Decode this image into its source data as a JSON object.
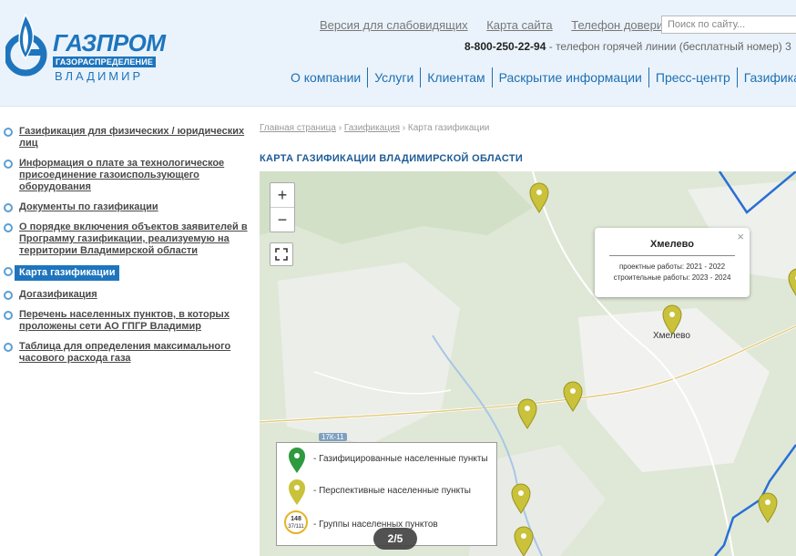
{
  "header": {
    "logo": {
      "word": "ГАЗПРОМ",
      "sub": "ГАЗОРАСПРЕДЕЛЕНИЕ",
      "city": "ВЛАДИМИР"
    },
    "top_links": [
      "Версия для слабовидящих",
      "Карта сайта",
      "Телефон доверия"
    ],
    "search_placeholder": "Поиск по сайту...",
    "hotline_number": "8-800-250-22-94",
    "hotline_text": " - телефон горячей линии (бесплатный номер) 3",
    "nav": [
      "О компании",
      "Услуги",
      "Клиентам",
      "Раскрытие информации",
      "Пресс-центр",
      "Газифика"
    ]
  },
  "sidebar": {
    "items": [
      "Газификация для физических / юридических лиц",
      "Информация о плате за технологическое присоединение газоиспользующего оборудования",
      "Документы по газификации",
      "О порядке включения объектов заявителей в Программу газификации, реализуемую на территории Владимирской области",
      "Карта газификации",
      "Догазификация",
      "Перечень населенных пунктов, в которых проложены сети АО ГПГР Владимир",
      "Таблица для определения максимального часового расхода газа"
    ]
  },
  "breadcrumb": {
    "home": "Главная страница",
    "section": "Газификация",
    "current": "Карта газификации"
  },
  "page_title": "КАРТА ГАЗИФИКАЦИИ ВЛАДИМИРСКОЙ ОБЛАСТИ",
  "map": {
    "zoom_in": "+",
    "zoom_out": "−",
    "road_label": "17К-11",
    "place_label": "Хмелево",
    "popup": {
      "title": "Хмелево",
      "line1": "проектные работы: 2021 - 2022",
      "line2": "строительные работы: 2023 - 2024",
      "close": "×"
    },
    "legend": {
      "gasified": "- Газифицированные населенные пункты",
      "prospective": "- Перспективные населенные пункты",
      "groups": "- Группы населенных пунктов",
      "cluster_top": "148",
      "cluster_bottom": "37/111"
    },
    "pager": "2/5"
  },
  "colors": {
    "brand": "#1e75bd",
    "pin_yellow": "#c9c23a",
    "pin_green": "#2e9a3e",
    "border": "#2a6fd6"
  }
}
